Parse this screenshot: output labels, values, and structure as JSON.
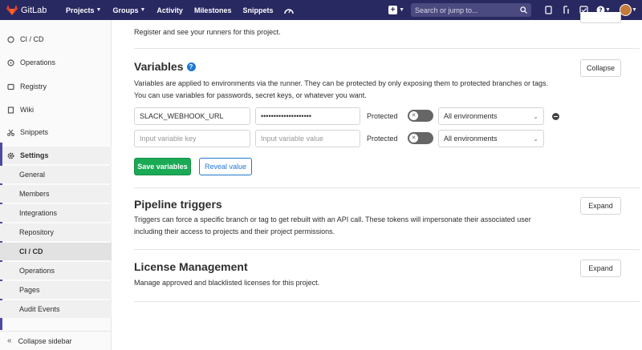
{
  "nav": {
    "brand": "GitLab",
    "items": [
      "Projects",
      "Groups",
      "Activity",
      "Milestones",
      "Snippets"
    ],
    "search_placeholder": "Search or jump to..."
  },
  "sidebar": {
    "items": [
      "CI / CD",
      "Operations",
      "Registry",
      "Wiki",
      "Snippets",
      "Settings"
    ],
    "settings_sub": [
      "General",
      "Members",
      "Integrations",
      "Repository",
      "CI / CD",
      "Operations",
      "Pages",
      "Audit Events"
    ],
    "collapse": "Collapse sidebar"
  },
  "runners": {
    "note": "Register and see your runners for this project."
  },
  "variables": {
    "title": "Variables",
    "desc1": "Variables are applied to environments via the runner. They can be protected by only exposing them to protected branches or tags.",
    "desc2": "You can use variables for passwords, secret keys, or whatever you want.",
    "collapse": "Collapse",
    "row1": {
      "key": "SLACK_WEBHOOK_URL",
      "value": "••••••••••••••••••••",
      "protected": "Protected",
      "env": "All environments"
    },
    "row2": {
      "key_ph": "Input variable key",
      "value_ph": "Input variable value",
      "protected": "Protected",
      "env": "All environments"
    },
    "save": "Save variables",
    "reveal": "Reveal value"
  },
  "triggers": {
    "title": "Pipeline triggers",
    "desc1": "Triggers can force a specific branch or tag to get rebuilt with an API call. These tokens will impersonate their associated user",
    "desc2": "including their access to projects and their project permissions.",
    "expand": "Expand"
  },
  "license": {
    "title": "License Management",
    "desc": "Manage approved and blacklisted licenses for this project.",
    "expand": "Expand"
  },
  "colors": {
    "nav": "#292961",
    "accent": "#1f78d1",
    "success": "#1aaa55"
  }
}
